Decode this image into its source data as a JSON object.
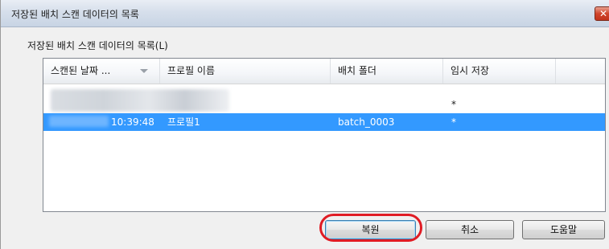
{
  "window": {
    "title": "저장된 배치 스캔 데이터의 목록",
    "close_symbol": "✕"
  },
  "list": {
    "label": "저장된 배치 스캔 데이터의 목록(L)",
    "columns": [
      "스캔된 날짜 ...",
      "프로필 이름",
      "배치 폴더",
      "임시 저장"
    ],
    "sort_icon": "chevron-down-icon",
    "rows": [
      {
        "date": "",
        "profile": "",
        "folder": "",
        "temp": "*",
        "selected": false,
        "redacted": true
      },
      {
        "date": "10:39:48",
        "profile": "프로필1",
        "folder": "batch_0003",
        "temp": "*",
        "selected": true,
        "redacted": true
      }
    ]
  },
  "buttons": {
    "restore": "복원",
    "cancel": "취소",
    "help": "도움말"
  },
  "colors": {
    "selection": "#3399ff",
    "highlight_ring": "#e01c24"
  }
}
